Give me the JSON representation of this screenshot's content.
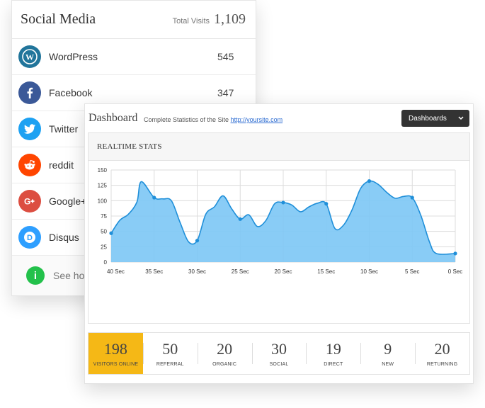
{
  "social_media": {
    "title": "Social Media",
    "total_label": "Total Visits",
    "total_value": "1,109",
    "items": [
      {
        "name": "WordPress",
        "count": "545",
        "icon": "wordpress-icon",
        "color": "#21759b"
      },
      {
        "name": "Facebook",
        "count": "347",
        "icon": "facebook-icon",
        "color": "#3b5998"
      },
      {
        "name": "Twitter",
        "count": "",
        "icon": "twitter-icon",
        "color": "#1da1f2"
      },
      {
        "name": "reddit",
        "count": "",
        "icon": "reddit-icon",
        "color": "#ff4500"
      },
      {
        "name": "Google+",
        "count": "",
        "icon": "google-plus-icon",
        "color": "#dc4e41"
      },
      {
        "name": "Disqus",
        "count": "",
        "icon": "disqus-icon",
        "color": "#2e9fff"
      }
    ],
    "footer_text": "See how"
  },
  "dashboard": {
    "title": "Dashboard",
    "subtitle": "Complete Statistics of the Site",
    "link": "http://yoursite.com",
    "dropdown_label": "Dashboards",
    "panel_title": "REALTIME STATS",
    "stats": [
      {
        "value": "198",
        "label": "VISITORS ONLINE",
        "active": true
      },
      {
        "value": "50",
        "label": "REFERRAL"
      },
      {
        "value": "20",
        "label": "ORGANIC"
      },
      {
        "value": "30",
        "label": "SOCIAL"
      },
      {
        "value": "19",
        "label": "DIRECT"
      },
      {
        "value": "9",
        "label": "NEW"
      },
      {
        "value": "20",
        "label": "RETURNING"
      }
    ],
    "accent_color": "#f5b816"
  },
  "chart_data": {
    "type": "area",
    "x_tick_labels": [
      "40 Sec",
      "35 Sec",
      "30 Sec",
      "25 Sec",
      "20 Sec",
      "15 Sec",
      "10 Sec",
      "5 Sec",
      "0 Sec"
    ],
    "y_ticks": [
      0,
      25,
      50,
      75,
      100,
      125,
      150
    ],
    "ylim": [
      0,
      150
    ],
    "x": [
      40,
      39,
      38,
      37,
      36.5,
      35,
      34,
      33,
      32,
      31,
      30,
      29,
      28,
      27,
      26,
      25,
      24,
      23,
      22,
      21,
      20,
      19,
      18,
      17,
      16,
      15,
      14,
      13,
      12,
      11,
      10,
      9,
      8,
      7,
      6,
      5,
      4,
      3,
      2.2,
      0
    ],
    "values": [
      47,
      68,
      78,
      98,
      131,
      105,
      103,
      100,
      65,
      33,
      35,
      78,
      90,
      108,
      87,
      70,
      77,
      58,
      68,
      95,
      97,
      93,
      82,
      90,
      96,
      95,
      55,
      60,
      85,
      120,
      132,
      127,
      114,
      104,
      107,
      105,
      76,
      33,
      14,
      14
    ],
    "marked_points": [
      [
        40,
        47
      ],
      [
        35,
        105
      ],
      [
        30,
        35
      ],
      [
        25,
        70
      ],
      [
        20,
        97
      ],
      [
        15,
        95
      ],
      [
        10,
        132
      ],
      [
        5,
        105
      ],
      [
        0,
        14
      ]
    ],
    "fill_color": "#7cc6f5",
    "line_color": "#1f8fd9",
    "grid": true
  }
}
